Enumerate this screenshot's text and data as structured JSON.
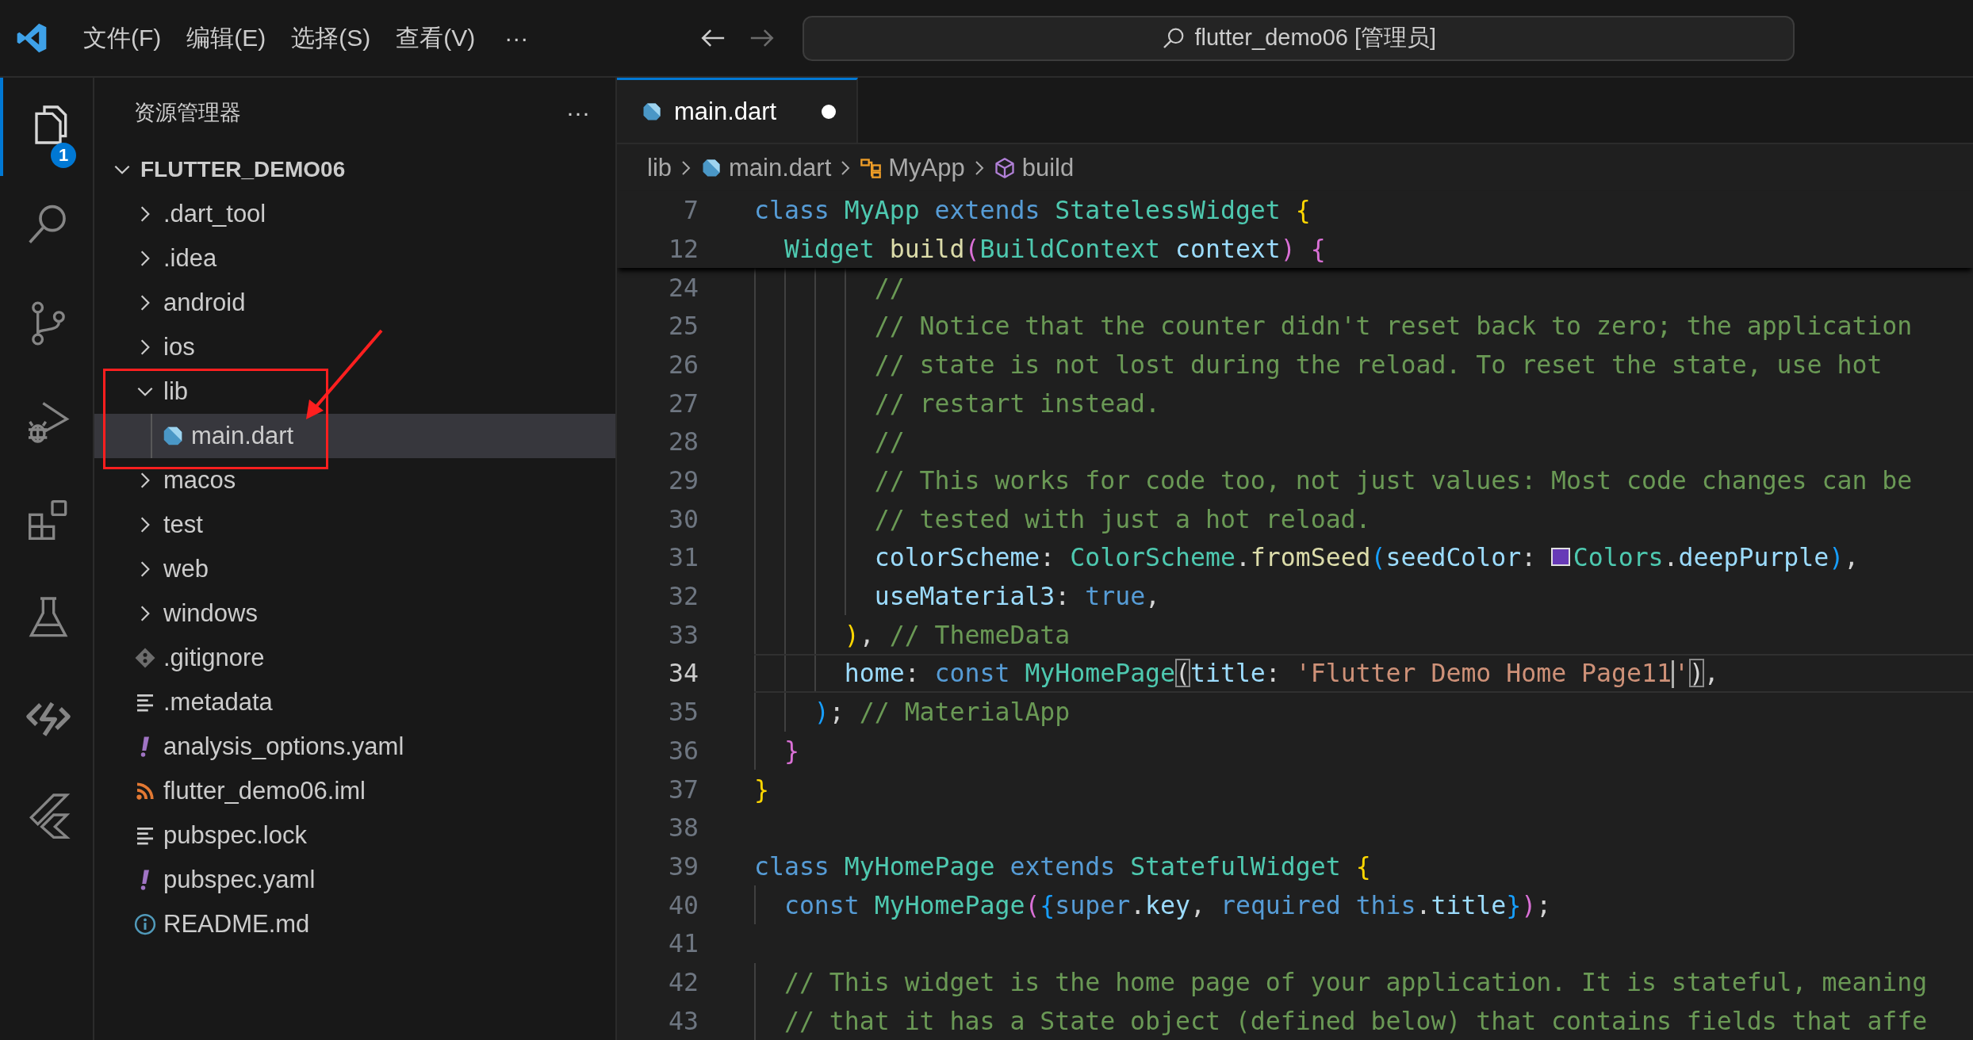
{
  "title_bar": {
    "menus": [
      "文件(F)",
      "编辑(E)",
      "选择(S)",
      "查看(V)"
    ],
    "more": "···",
    "nav": [
      {
        "kind": "back",
        "disabled": false
      },
      {
        "kind": "forward",
        "disabled": true
      }
    ],
    "search": "flutter_demo06 [管理员]"
  },
  "activity_bar": [
    {
      "kind": "explorer",
      "selected": true,
      "badge": "1"
    },
    {
      "kind": "search",
      "selected": false
    },
    {
      "kind": "source-control",
      "selected": false
    },
    {
      "kind": "run-debug",
      "selected": false
    },
    {
      "kind": "extensions",
      "selected": false
    },
    {
      "kind": "testing",
      "selected": false
    },
    {
      "kind": "remote",
      "selected": false
    },
    {
      "kind": "flutter",
      "selected": false
    }
  ],
  "explorer": {
    "title": "资源管理器",
    "more": "···",
    "root": {
      "label": "FLUTTER_DEMO06",
      "expanded": true,
      "selected": false,
      "children": [
        {
          "kind": "folder",
          "label": ".dart_tool",
          "expanded": false,
          "selected": false
        },
        {
          "kind": "folder",
          "label": ".idea",
          "expanded": false,
          "selected": false
        },
        {
          "kind": "folder",
          "label": "android",
          "expanded": false,
          "selected": false
        },
        {
          "kind": "folder",
          "label": "ios",
          "expanded": false,
          "selected": false
        },
        {
          "kind": "folder",
          "label": "lib",
          "expanded": true,
          "selected": false,
          "children": [
            {
              "kind": "dart",
              "label": "main.dart",
              "selected": true
            }
          ]
        },
        {
          "kind": "folder",
          "label": "macos",
          "expanded": false,
          "selected": false
        },
        {
          "kind": "folder",
          "label": "test",
          "expanded": false,
          "selected": false
        },
        {
          "kind": "folder",
          "label": "web",
          "expanded": false,
          "selected": false
        },
        {
          "kind": "folder",
          "label": "windows",
          "expanded": false,
          "selected": false
        },
        {
          "kind": "git",
          "label": ".gitignore",
          "selected": false
        },
        {
          "kind": "lines",
          "label": ".metadata",
          "selected": false
        },
        {
          "kind": "yaml",
          "label": "analysis_options.yaml",
          "selected": false
        },
        {
          "kind": "feed",
          "label": "flutter_demo06.iml",
          "selected": false
        },
        {
          "kind": "lines",
          "label": "pubspec.lock",
          "selected": false
        },
        {
          "kind": "yaml",
          "label": "pubspec.yaml",
          "selected": false
        },
        {
          "kind": "info",
          "label": "README.md",
          "selected": false
        }
      ]
    }
  },
  "editor": {
    "tabs": [
      {
        "label": "main.dart",
        "selected": true,
        "modified": true
      }
    ],
    "breadcrumb": [
      {
        "kind": "folder",
        "label": "lib"
      },
      {
        "kind": "dart",
        "label": "main.dart"
      },
      {
        "kind": "class",
        "label": "MyApp"
      },
      {
        "kind": "method",
        "label": "build"
      }
    ],
    "sticky_lines": [
      {
        "number": "7",
        "tokens": [
          {
            "kind": "kw",
            "text": "class "
          },
          {
            "kind": "type",
            "text": "MyApp "
          },
          {
            "kind": "kw",
            "text": "extends "
          },
          {
            "kind": "type",
            "text": "StatelessWidget "
          },
          {
            "kind": "b1",
            "text": "{"
          }
        ]
      },
      {
        "number": "12",
        "tokens": [
          {
            "kind": "type",
            "text": "  Widget "
          },
          {
            "kind": "fn",
            "text": "build"
          },
          {
            "kind": "b2",
            "text": "("
          },
          {
            "kind": "type",
            "text": "BuildContext "
          },
          {
            "kind": "var",
            "text": "context"
          },
          {
            "kind": "b2",
            "text": ") {"
          }
        ]
      }
    ],
    "lines": [
      {
        "number": "24",
        "current": false,
        "tokens": [
          {
            "kind": "cm",
            "text": "        //"
          }
        ]
      },
      {
        "number": "25",
        "current": false,
        "tokens": [
          {
            "kind": "cm",
            "text": "        // Notice that the counter didn't reset back to zero; the application"
          }
        ]
      },
      {
        "number": "26",
        "current": false,
        "tokens": [
          {
            "kind": "cm",
            "text": "        // state is not lost during the reload. To reset the state, use hot"
          }
        ]
      },
      {
        "number": "27",
        "current": false,
        "tokens": [
          {
            "kind": "cm",
            "text": "        // restart instead."
          }
        ]
      },
      {
        "number": "28",
        "current": false,
        "tokens": [
          {
            "kind": "cm",
            "text": "        //"
          }
        ]
      },
      {
        "number": "29",
        "current": false,
        "tokens": [
          {
            "kind": "cm",
            "text": "        // This works for code too, not just values: Most code changes can be"
          }
        ]
      },
      {
        "number": "30",
        "current": false,
        "tokens": [
          {
            "kind": "cm",
            "text": "        // tested with just a hot reload."
          }
        ]
      },
      {
        "number": "31",
        "current": false,
        "tokens": [
          {
            "kind": "var",
            "text": "        colorScheme"
          },
          {
            "kind": "p",
            "text": ": "
          },
          {
            "kind": "type",
            "text": "ColorScheme"
          },
          {
            "kind": "p",
            "text": "."
          },
          {
            "kind": "fn",
            "text": "fromSeed"
          },
          {
            "kind": "b3",
            "text": "("
          },
          {
            "kind": "var",
            "text": "seedColor"
          },
          {
            "kind": "p",
            "text": ": "
          },
          {
            "kind": "swatch",
            "color": "#673ab7"
          },
          {
            "kind": "type",
            "text": "Colors"
          },
          {
            "kind": "p",
            "text": "."
          },
          {
            "kind": "var",
            "text": "deepPurple"
          },
          {
            "kind": "b3",
            "text": ")"
          },
          {
            "kind": "p",
            "text": ","
          }
        ]
      },
      {
        "number": "32",
        "current": false,
        "tokens": [
          {
            "kind": "var",
            "text": "        useMaterial3"
          },
          {
            "kind": "p",
            "text": ": "
          },
          {
            "kind": "kw",
            "text": "true"
          },
          {
            "kind": "p",
            "text": ","
          }
        ]
      },
      {
        "number": "33",
        "current": false,
        "tokens": [
          {
            "kind": "b1",
            "text": "      )"
          },
          {
            "kind": "p",
            "text": ", "
          },
          {
            "kind": "cm",
            "text": "// ThemeData"
          }
        ]
      },
      {
        "number": "34",
        "current": true,
        "tokens": [
          {
            "kind": "var",
            "text": "      home"
          },
          {
            "kind": "p",
            "text": ": "
          },
          {
            "kind": "kw",
            "text": "const "
          },
          {
            "kind": "type",
            "text": "MyHomePage"
          },
          {
            "kind": "match",
            "text": "("
          },
          {
            "kind": "var",
            "text": "title"
          },
          {
            "kind": "p",
            "text": ": "
          },
          {
            "kind": "str",
            "text": "'Flutter Demo Home Page11"
          },
          {
            "kind": "cursor"
          },
          {
            "kind": "str",
            "text": "'"
          },
          {
            "kind": "match",
            "text": ")"
          },
          {
            "kind": "p",
            "text": ","
          }
        ]
      },
      {
        "number": "35",
        "current": false,
        "tokens": [
          {
            "kind": "b3",
            "text": "    )"
          },
          {
            "kind": "p",
            "text": "; "
          },
          {
            "kind": "cm",
            "text": "// MaterialApp"
          }
        ]
      },
      {
        "number": "36",
        "current": false,
        "tokens": [
          {
            "kind": "b2",
            "text": "  }"
          }
        ]
      },
      {
        "number": "37",
        "current": false,
        "tokens": [
          {
            "kind": "b1",
            "text": "}"
          }
        ]
      },
      {
        "number": "38",
        "current": false
      },
      {
        "number": "39",
        "current": false,
        "tokens": [
          {
            "kind": "kw",
            "text": "class "
          },
          {
            "kind": "type",
            "text": "MyHomePage "
          },
          {
            "kind": "kw",
            "text": "extends "
          },
          {
            "kind": "type",
            "text": "StatefulWidget "
          },
          {
            "kind": "b1",
            "text": "{"
          }
        ]
      },
      {
        "number": "40",
        "current": false,
        "tokens": [
          {
            "kind": "kw",
            "text": "  const "
          },
          {
            "kind": "type",
            "text": "MyHomePage"
          },
          {
            "kind": "b2",
            "text": "("
          },
          {
            "kind": "b3",
            "text": "{"
          },
          {
            "kind": "kw",
            "text": "super"
          },
          {
            "kind": "p",
            "text": "."
          },
          {
            "kind": "var",
            "text": "key"
          },
          {
            "kind": "p",
            "text": ", "
          },
          {
            "kind": "kw",
            "text": "required this"
          },
          {
            "kind": "p",
            "text": "."
          },
          {
            "kind": "var",
            "text": "title"
          },
          {
            "kind": "b3",
            "text": "}"
          },
          {
            "kind": "b2",
            "text": ")"
          },
          {
            "kind": "p",
            "text": ";"
          }
        ]
      },
      {
        "number": "41",
        "current": false
      },
      {
        "number": "42",
        "current": false,
        "tokens": [
          {
            "kind": "cm",
            "text": "  // This widget is the home page of your application. It is stateful, meaning"
          }
        ]
      },
      {
        "number": "43",
        "current": false,
        "tokens": [
          {
            "kind": "cm",
            "text": "  // that it has a State object (defined below) that contains fields that affe"
          }
        ]
      }
    ]
  }
}
